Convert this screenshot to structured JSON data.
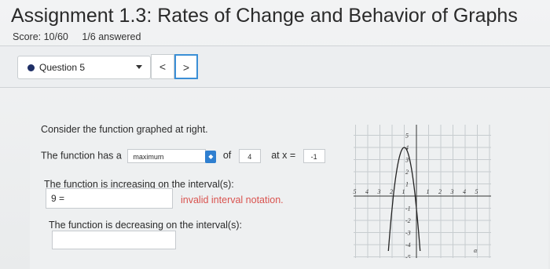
{
  "title": "Assignment 1.3: Rates of Change and Behavior of Graphs",
  "score": "Score: 10/60",
  "answered": "1/6 answered",
  "question_nav": {
    "current": "Question 5",
    "prev": "<",
    "next": ">"
  },
  "question": {
    "prompt": "Consider the function graphed at right.",
    "row1_prefix": "The function has a",
    "extremum_selected": "maximum",
    "of_label": "of",
    "value_of": "4",
    "at_label": "at x =",
    "at_value": "-1",
    "increasing_label": "The function is increasing on the interval(s):",
    "increasing_answer": "9 =",
    "error_text": "invalid interval notation.",
    "decreasing_label": "The function is decreasing on the interval(s):",
    "decreasing_answer": ""
  },
  "graph": {
    "x_ticks": [
      "5",
      "4",
      "3",
      "2",
      "1",
      "1",
      "2",
      "3",
      "4",
      "5"
    ],
    "y_ticks": [
      "5",
      "4",
      "3",
      "2",
      "1",
      "-1",
      "-2",
      "-3",
      "-4",
      "-5"
    ],
    "corner_label": "α",
    "vertex": [
      -1,
      4
    ]
  }
}
